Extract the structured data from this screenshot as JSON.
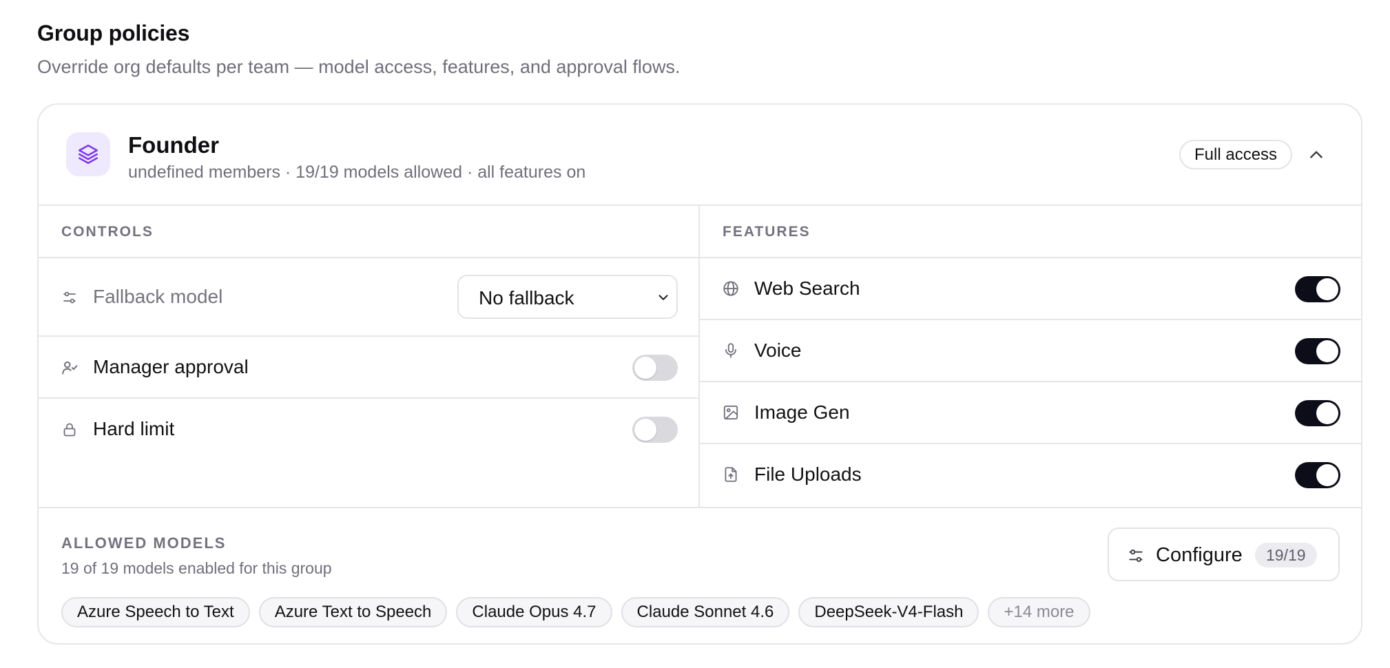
{
  "page": {
    "title": "Group policies",
    "subtitle": "Override org defaults per team — model access, features, and approval flows."
  },
  "group": {
    "name": "Founder",
    "meta": "undefined members · 19/19 models allowed · all features on",
    "badge": "Full access",
    "icon": "layers-icon",
    "accent_color": "#7c3aed"
  },
  "controls": {
    "label": "CONTROLS",
    "fallback": {
      "label": "Fallback model",
      "value": "No fallback",
      "icon": "sliders-icon"
    },
    "manager_approval": {
      "label": "Manager approval",
      "enabled": false,
      "icon": "user-check-icon"
    },
    "hard_limit": {
      "label": "Hard limit",
      "enabled": false,
      "icon": "lock-icon"
    }
  },
  "features": {
    "label": "FEATURES",
    "items": [
      {
        "label": "Web Search",
        "enabled": true,
        "icon": "globe-icon"
      },
      {
        "label": "Voice",
        "enabled": true,
        "icon": "microphone-icon"
      },
      {
        "label": "Image Gen",
        "enabled": true,
        "icon": "image-icon"
      },
      {
        "label": "File Uploads",
        "enabled": true,
        "icon": "file-upload-icon"
      }
    ]
  },
  "allowed_models": {
    "label": "ALLOWED MODELS",
    "summary": "19 of 19 models enabled for this group",
    "configure_label": "Configure",
    "configure_count": "19/19",
    "chips": [
      "Azure Speech to Text",
      "Azure Text to Speech",
      "Claude Opus 4.7",
      "Claude Sonnet 4.6",
      "DeepSeek-V4-Flash"
    ],
    "more_label": "+14 more"
  },
  "colors": {
    "toggle_on": "#0c0d18",
    "toggle_off": "#d9d9de",
    "muted_text": "#6f6f7b",
    "border": "#e6e6ea"
  }
}
